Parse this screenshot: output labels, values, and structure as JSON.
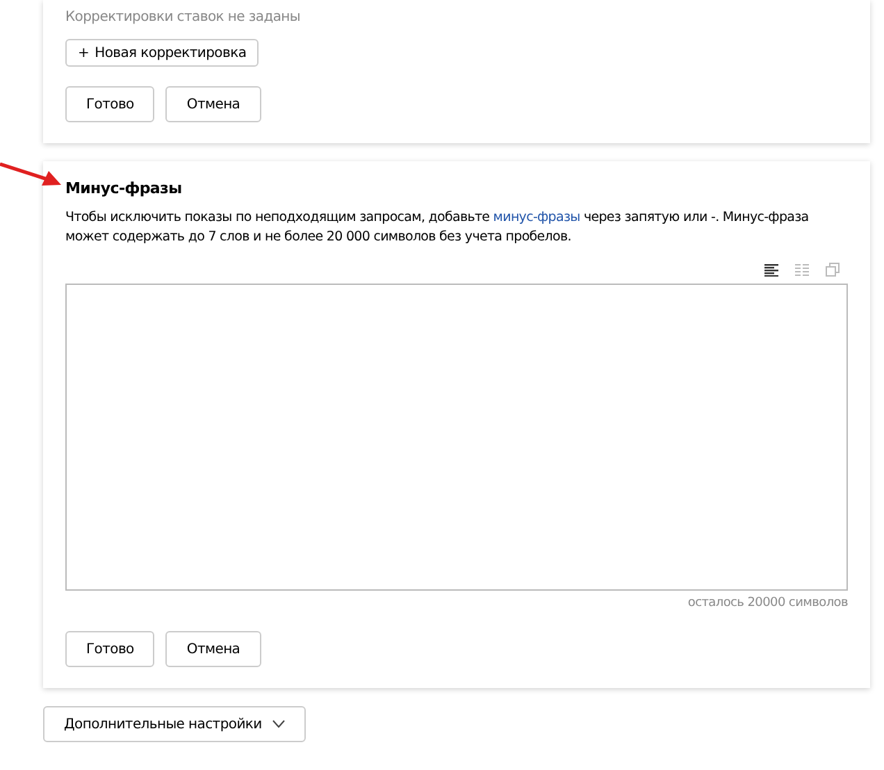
{
  "adjustments_card": {
    "empty_note": "Корректировки ставок не заданы",
    "new_button": {
      "icon": "+",
      "label": "Новая корректировка"
    },
    "buttons": [
      "Готово",
      "Отмена"
    ]
  },
  "minus_phrases_card": {
    "title": "Минус-фразы",
    "description": {
      "before": "Чтобы исключить показы по неподходящим запросам, добавьте ",
      "link": "минус-фразы",
      "after": " через запятую или -. Минус-фраза может содержать до 7 слов и не более 20 000 символов без учета пробелов."
    },
    "toolbar": [
      {
        "kind": "text-mode",
        "selected": true
      },
      {
        "kind": "list-mode",
        "selected": false
      },
      {
        "kind": "copy",
        "selected": false
      }
    ],
    "counter": "осталось 20000 символов",
    "buttons": [
      "Готово",
      "Отмена"
    ]
  },
  "more_settings": {
    "label": "Дополнительные настройки"
  }
}
